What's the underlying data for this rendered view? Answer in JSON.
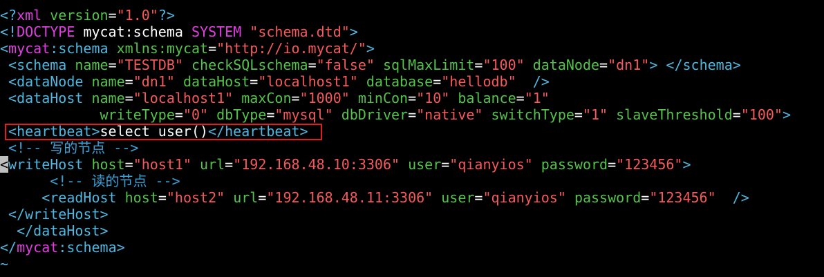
{
  "editor": {
    "colors": {
      "background": "#000000",
      "tag": "#4fb6e0",
      "namespace": "#e13ee1",
      "attribute": "#55c24b",
      "value": "#f45a5a",
      "text": "#ffffff",
      "comment": "#3aa0d6",
      "highlight_box": "#e02020"
    },
    "lines": {
      "l1": {
        "open": "<?",
        "name": "xml",
        "attr": "version",
        "eq": "=",
        "val": "\"1.0\"",
        "close": "?>"
      },
      "l2": {
        "open": "<!",
        "kw": "DOCTYPE",
        "text": "mycat:schema",
        "kw2": "SYSTEM",
        "val": "\"schema.dtd\"",
        "close": ">"
      },
      "l3": {
        "open": "<",
        "ns": "mycat",
        "sep": ":",
        "tag": "schema",
        "attr": "xmlns:mycat",
        "eq": "=",
        "val": "\"http://io.mycat/\"",
        "close": ">"
      },
      "l4": {
        "open": "<schema",
        "a1": "name",
        "v1": "\"TESTDB\"",
        "a2": "checkSQLschema",
        "v2": "\"false\"",
        "a3": "sqlMaxLimit",
        "v3": "\"100\"",
        "a4": "dataNode",
        "v4": "\"dn1\"",
        "close": ">",
        "endtag": "</schema>"
      },
      "l5": {
        "open": "<dataNode",
        "a1": "name",
        "v1": "\"dn1\"",
        "a2": "dataHost",
        "v2": "\"localhost1\"",
        "a3": "database",
        "v3": "\"hellodb\"",
        "close": "/>"
      },
      "l6": {
        "open": "<dataHost",
        "a1": "name",
        "v1": "\"localhost1\"",
        "a2": "maxCon",
        "v2": "\"1000\"",
        "a3": "minCon",
        "v3": "\"10\"",
        "a4": "balance",
        "v4": "\"1\""
      },
      "l7": {
        "a1": "writeType",
        "v1": "\"0\"",
        "a2": "dbType",
        "v2": "\"mysql\"",
        "a3": "dbDriver",
        "v3": "\"native\"",
        "a4": "switchType",
        "v4": "\"1\"",
        "a5": "slaveThreshold",
        "v5": "\"100\"",
        "close": ">"
      },
      "l8": {
        "open": "<heartbeat>",
        "text": "select user()",
        "close": "</heartbeat>"
      },
      "l9": {
        "comment": "<!-- 写的节点 -->"
      },
      "l10": {
        "cursor": "<",
        "tag": "writeHost",
        "a1": "host",
        "v1": "\"host1\"",
        "a2": "url",
        "v2": "\"192.168.48.10:3306\"",
        "a3": "user",
        "v3": "\"qianyios\"",
        "a4": "password",
        "v4": "\"123456\"",
        "close": ">"
      },
      "l11": {
        "comment": "<!-- 读的节点 -->"
      },
      "l12": {
        "open": "<readHost",
        "a1": "host",
        "v1": "\"host2\"",
        "a2": "url",
        "v2": "\"192.168.48.11:3306\"",
        "a3": "user",
        "v3": "\"qianyios\"",
        "a4": "password",
        "v4": "\"123456\"",
        "close": "/>"
      },
      "l13": {
        "tag": "</writeHost>"
      },
      "l14": {
        "tag": "</dataHost>"
      },
      "l15": {
        "open": "</",
        "ns": "mycat",
        "sep": ":",
        "tag": "schema",
        "close": ">"
      },
      "l16": {
        "tilde": "~"
      }
    }
  }
}
